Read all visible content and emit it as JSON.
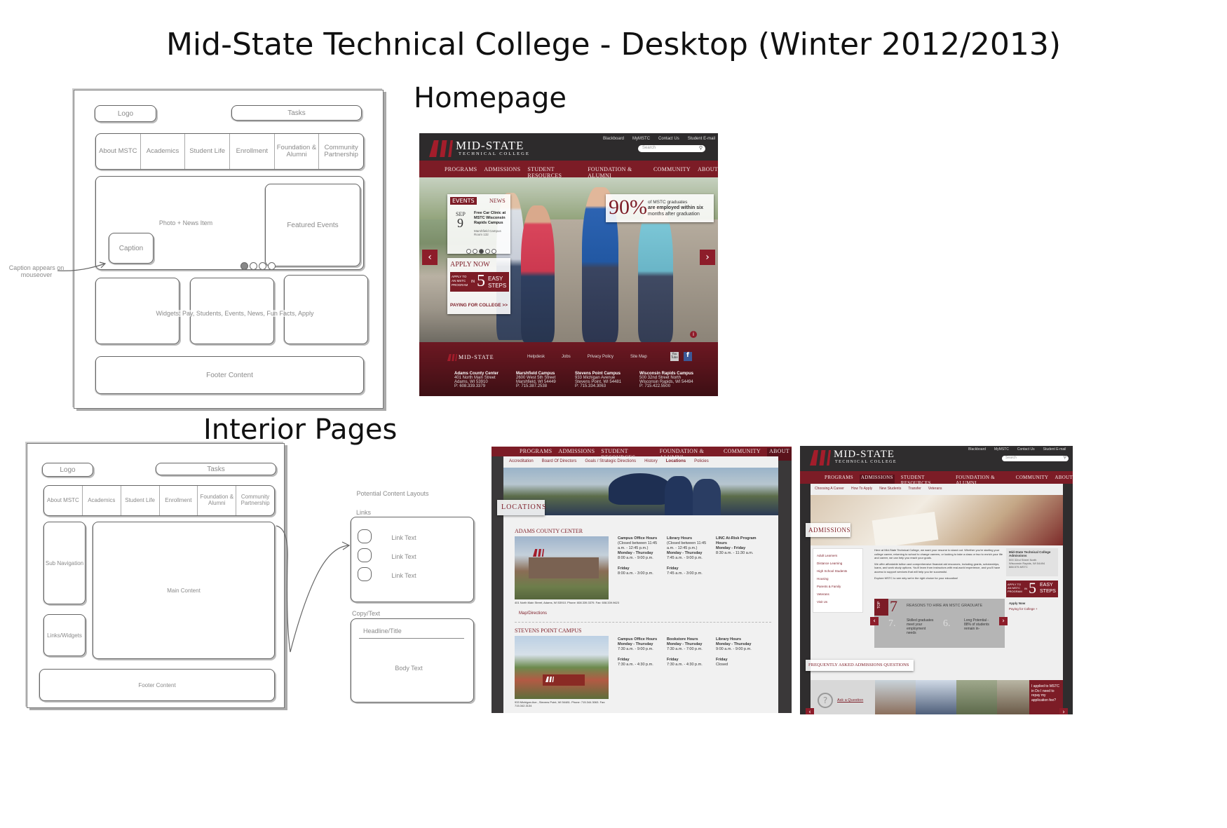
{
  "title": "Mid-State Technical College - Desktop (Winter 2012/2013)",
  "section_home": "Homepage",
  "section_interior": "Interior Pages",
  "wireframe_home": {
    "logo": "Logo",
    "tasks": "Tasks",
    "nav": [
      "About MSTC",
      "Academics",
      "Student Life",
      "Enrollment",
      "Foundation & Alumni",
      "Community Partnership"
    ],
    "photo_news": "Photo + News Item",
    "featured_events": "Featured Events",
    "caption": "Caption",
    "caption_note": "Caption appears on mouseover",
    "widgets": "Widgets: Pay, Students, Events, News, Fun Facts, Apply",
    "footer": "Footer Content"
  },
  "wireframe_interior": {
    "logo": "Logo",
    "tasks": "Tasks",
    "nav": [
      "About MSTC",
      "Academics",
      "Student Life",
      "Enrollment",
      "Foundation & Alumni",
      "Community Partnership"
    ],
    "sub_navigation": "Sub Navigation",
    "main_content": "Main Content",
    "links_widgets": "Links/Widgets",
    "footer": "Footer Content",
    "potential_layouts": "Potential Content Layouts",
    "links_label": "Links",
    "link_text": [
      "Link Text",
      "Link Text",
      "Link Text"
    ],
    "copy_text_label": "Copy/Text",
    "headline": "Headline/Title",
    "body_text": "Body Text"
  },
  "home_mock": {
    "logo_big": "MID-STATE",
    "logo_small": "TECHNICAL COLLEGE",
    "utility": [
      "Blackboard",
      "MyMSTC",
      "Contact Us",
      "Student E-mail"
    ],
    "search_placeholder": "Search",
    "nav": [
      "PROGRAMS",
      "ADMISSIONS",
      "STUDENT RESOURCES",
      "FOUNDATION & ALUMNI",
      "COMMUNITY",
      "ABOUT"
    ],
    "events_tab": "EVENTS",
    "news_tab": "NEWS",
    "event_month": "SEP",
    "event_day": "9",
    "event_title": "Free Car Clinic at MSTC Wisconsin Rapids Campus",
    "event_detail": "Marshfield Campus Room 132",
    "stat_number": "90%",
    "stat_line1": "of MSTC graduates",
    "stat_line2": "are employed within six",
    "stat_line3": "months after graduation",
    "apply_now": "APPLY NOW",
    "apply_text": "APPLY TO AN MSTC PROGRAM",
    "apply_in": "IN",
    "apply_five": "5",
    "apply_easy": "EASY",
    "apply_steps": "STEPS",
    "paying": "PAYING FOR COLLEGE >>",
    "footer_links": [
      "Helpdesk",
      "Jobs",
      "Privacy Policy",
      "Site Map"
    ],
    "campuses": [
      {
        "name": "Adams County Center",
        "street": "401 North Main Street",
        "city": "Adams, WI 53910",
        "phone": "P: 608.339.3379"
      },
      {
        "name": "Marshfield Campus",
        "street": "2600 West 5th Street",
        "city": "Marshfield, WI 54449",
        "phone": "P: 715.387.2538"
      },
      {
        "name": "Stevens Point Campus",
        "street": "933 Michigan Avenue",
        "city": "Stevens Point, WI 54481",
        "phone": "P: 715.334.3063"
      },
      {
        "name": "Wisconsin Rapids Campus",
        "street": "500 32nd Street North",
        "city": "Wisconsin Rapids, WI 54494",
        "phone": "P: 715.422.5500"
      }
    ],
    "youtube": "You Tube",
    "facebook": "f"
  },
  "locations_mock": {
    "nav": [
      "PROGRAMS",
      "ADMISSIONS",
      "STUDENT RESOURCES",
      "FOUNDATION & ALUMNI",
      "COMMUNITY",
      "ABOUT"
    ],
    "subnav": [
      "Accreditation",
      "Board Of Directors",
      "Goals / Strategic Directions",
      "History",
      "Locations",
      "Policies"
    ],
    "page_title": "LOCATIONS",
    "center1": "ADAMS COUNTY CENTER",
    "center1_address": "401 North Main Street, Adams, WI 53910. Phone: 608.339.3379. Fax: 608.339.9623",
    "map_link": "Map/Directions",
    "hours1": [
      {
        "title": "Campus Office Hours",
        "lines": [
          "(Closed between 11:45 a.m. - 12:45 p.m.)",
          "Monday - Thursday",
          "8:00 a.m. - 9:00 p.m.",
          "",
          "Friday",
          "8:00 a.m. - 3:00 p.m."
        ]
      },
      {
        "title": "Library Hours",
        "lines": [
          "(Closed between 11:45 a.m. - 12:45 p.m.)",
          "Monday - Thursday",
          "7:45 a.m. - 9:00 p.m.",
          "",
          "Friday",
          "7:45 a.m. - 3:00 p.m."
        ]
      },
      {
        "title": "LINC At-Risk Program Hours",
        "lines": [
          "Monday - Friday",
          "8:30 a.m. - 11:30 a.m."
        ]
      }
    ],
    "center2": "STEVENS POINT CAMPUS",
    "center2_address": "933 Michigan Ave., Stevens Point, WI 54481. Phone: 715.344.3063. Fax: 715.342.3134",
    "hours2": [
      {
        "title": "Campus Office Hours",
        "lines": [
          "Monday - Thursday",
          "7:30 a.m. - 9:00 p.m.",
          "",
          "Friday",
          "7:30 a.m. - 4:30 p.m."
        ]
      },
      {
        "title": "Bookstore Hours",
        "lines": [
          "Monday - Thursday",
          "7:30 a.m. - 7:00 p.m.",
          "",
          "Friday",
          "7:30 a.m. - 4:30 p.m."
        ]
      },
      {
        "title": "Library Hours",
        "lines": [
          "Monday - Thursday",
          "9:00 a.m. - 9:00 p.m.",
          "",
          "Friday",
          "Closed"
        ]
      }
    ]
  },
  "admissions_mock": {
    "logo_big": "MID-STATE",
    "logo_small": "TECHNICAL COLLEGE",
    "utility": [
      "Blackboard",
      "MyMSTC",
      "Contact Us",
      "Student E-mail"
    ],
    "search_placeholder": "Search",
    "nav": [
      "PROGRAMS",
      "ADMISSIONS",
      "STUDENT RESOURCES",
      "FOUNDATION & ALUMNI",
      "COMMUNITY",
      "ABOUT"
    ],
    "subnav": [
      "Choosing A Career",
      "How To Apply",
      "New Students",
      "Transfer",
      "Veterans"
    ],
    "page_title": "ADMISSIONS",
    "sidebar": [
      "Adult Learners",
      "Distance Learning",
      "High School Students",
      "Housing",
      "Parents & Family",
      "Veterans",
      "Visit Us"
    ],
    "intro": "Here at Mid-State Technical College, we want your resume to stand out. Whether you're starting your college career, returning to school to change careers, or looking to take a class or two to enrich your life and career, we can help you reach your goals.",
    "intro2": "We offer affordable tuition and comprehensive financial aid resources, including grants, scholarships, loans, and work study options. You'll learn from instructors with real-world experience, and you'll have access to support services that will help you be successful.",
    "intro3": "Explore MSTC to see why we're the right choice for your education!",
    "contact_title": "Mid-State Technical College Admissions",
    "contact_lines": [
      "500 32nd Street North",
      "Wisconsin Rapids, WI 54494",
      "888.575.MSTC"
    ],
    "apply_text": "APPLY TO AN MSTC PROGRAM",
    "apply_in": "IN",
    "apply_five": "5",
    "apply_easy": "EASY",
    "apply_steps": "STEPS",
    "apply_now": "Apply Now",
    "paying": "Paying for College +",
    "top_label": "TOP",
    "top_number": "7",
    "reasons_title": "REASONS TO HIRE AN MSTC GRADUATE",
    "reason1_num": "7.",
    "reason1_text": "Skilled graduates meet your employment needs",
    "reason2_num": "6.",
    "reason2_text": "Long Potential - 88% of students remain in-",
    "faq": "FREQUENTLY ASKED ADMISSIONS QUESTIONS",
    "ask": "Ask a Question",
    "question": "I applied to MSTC in Do I need to repay my application fee?"
  }
}
